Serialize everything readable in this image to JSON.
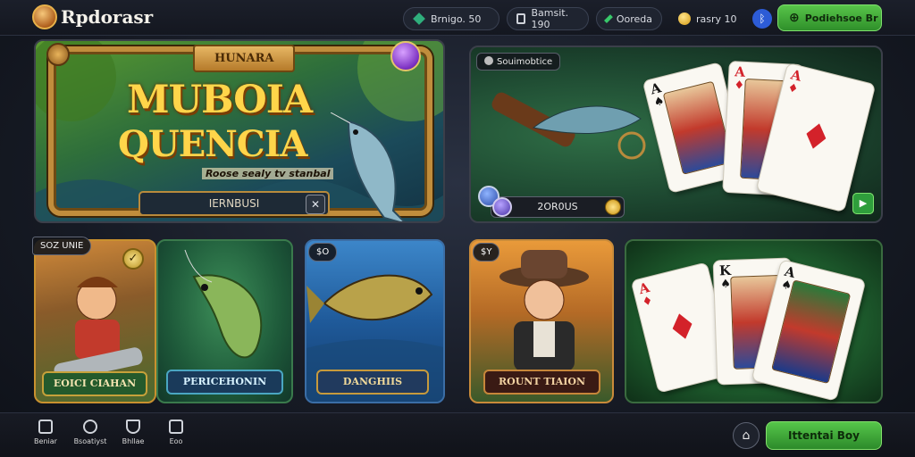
{
  "app": {
    "logo_text": "Rpdorasr"
  },
  "topbar": {
    "pills": [
      {
        "icon": "gem-icon",
        "label": "Brnigo. 50"
      },
      {
        "icon": "calendar-icon",
        "label": "Bamsit. 190"
      },
      {
        "icon": "diamond-icon",
        "label": "Ooreda"
      },
      {
        "icon": "coin-icon",
        "label": "rasry 10"
      }
    ],
    "cta_label": "Podiehsoe Br"
  },
  "hero": {
    "tag": "HUNARA",
    "title_line1": "MUBOIA",
    "title_line2": "QUENCIA",
    "subtitle": "Roose sealy tv stanbal",
    "button_label": "IERNBUSI"
  },
  "card_top_right": {
    "tag": "Souimobtice",
    "bar_label": "2OR0US",
    "cards": [
      {
        "rank": "A",
        "suit": "♠"
      },
      {
        "rank": "A",
        "suit": "♦"
      },
      {
        "rank": "A",
        "suit": "♦"
      }
    ]
  },
  "row": {
    "c1": {
      "tag": "SOZ UNIE",
      "label": "EOICI CIAHAN"
    },
    "c2": {
      "label": "PERICEHONIN"
    },
    "c3": {
      "tag": "$O",
      "label": "DANGHIIS"
    },
    "c4": {
      "tag": "$Y",
      "label": "ROUNT TIAION"
    },
    "c5": {
      "cards": [
        {
          "rank": "A",
          "suit": "♦"
        },
        {
          "rank": "K",
          "suit": "♠"
        },
        {
          "rank": "A",
          "suit": "♠"
        }
      ]
    }
  },
  "bottom": {
    "nav": [
      {
        "icon": "home-icon",
        "label": "Beniar"
      },
      {
        "icon": "search-icon",
        "label": "Bsoatiyst"
      },
      {
        "icon": "trophy-icon",
        "label": "Bhllae"
      },
      {
        "icon": "bag-icon",
        "label": "Eoo"
      }
    ],
    "cta_label": "Ittentai Boy"
  },
  "colors": {
    "accent_green": "#3fae3a",
    "gold": "#ffd54a"
  }
}
